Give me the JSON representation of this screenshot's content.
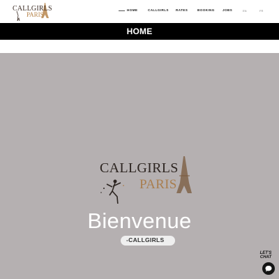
{
  "header": {
    "logo_line1": "CALLGIRLS",
    "logo_line2": "PARIS",
    "nav": [
      {
        "label": "HOME"
      },
      {
        "label": "CALLGIRLS"
      },
      {
        "label": "RATES"
      },
      {
        "label": "BOOKING"
      },
      {
        "label": "JOBS"
      }
    ],
    "lang_en": "EN",
    "lang_fr": "FR"
  },
  "page_title": "HOME",
  "hero": {
    "logo_line1": "CALLGIRLS",
    "logo_line2": "PARIS",
    "welcome": "Bienvenue",
    "tag": "-CALLGIRLS"
  },
  "chat": {
    "line1": "LET'S",
    "line2": "CHAT"
  },
  "colors": {
    "hero_bg": "#b5b0b1",
    "title_bar": "#000000",
    "brand_gold": "#a97e4f"
  },
  "icons": [
    "eiffel-tower-icon",
    "chat-bubble-icon"
  ]
}
